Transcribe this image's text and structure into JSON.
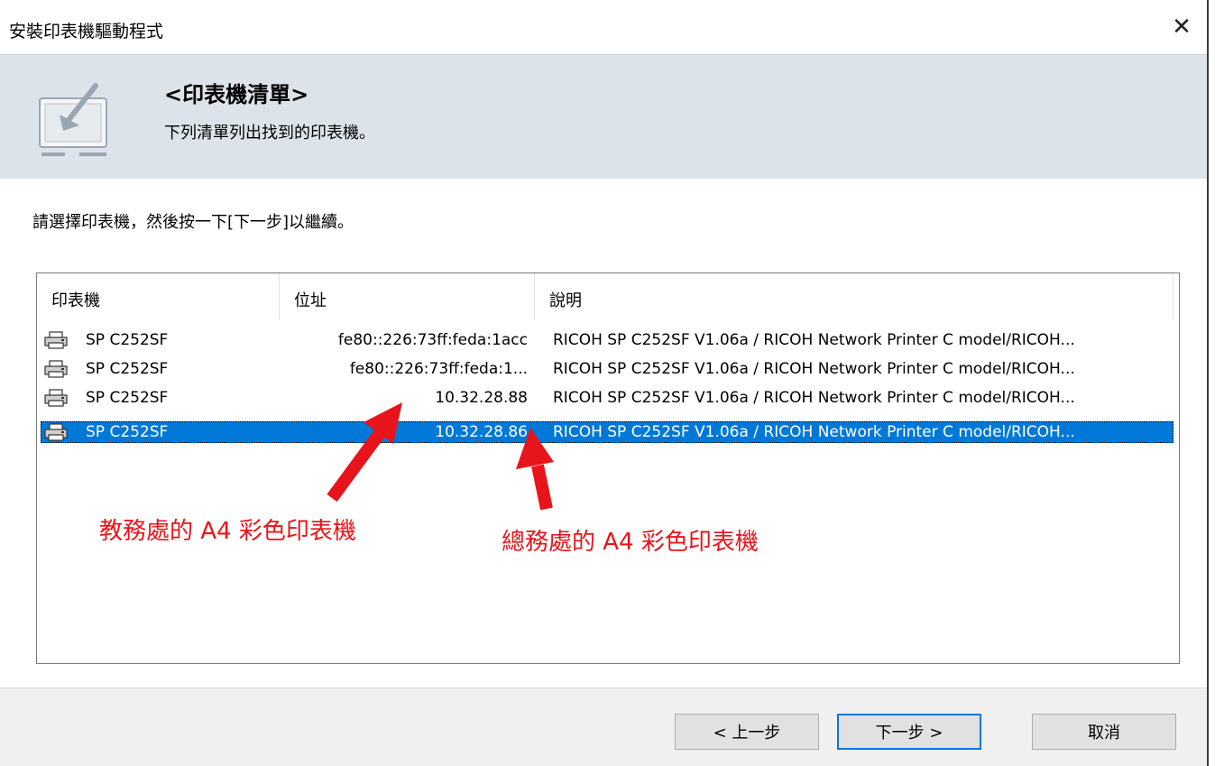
{
  "window": {
    "title": "安裝印表機驅動程式",
    "close_glyph": "✕"
  },
  "banner": {
    "heading": "<印表機清單>",
    "subheading": "下列清單列出找到的印表機。",
    "icon": "install-wizard-icon"
  },
  "instruction": "請選擇印表機，然後按一下[下一步]以繼續。",
  "list": {
    "columns": [
      "印表機",
      "位址",
      "說明"
    ],
    "rows": [
      {
        "name": "SP C252SF",
        "address": "fe80::226:73ff:feda:1acc",
        "description": "RICOH SP C252SF V1.06a / RICOH Network Printer C model/RICOH...",
        "selected": false
      },
      {
        "name": "SP C252SF",
        "address": "fe80::226:73ff:feda:1...",
        "description": "RICOH SP C252SF V1.06a / RICOH Network Printer C model/RICOH...",
        "selected": false
      },
      {
        "name": "SP C252SF",
        "address": "10.32.28.88",
        "description": "RICOH SP C252SF V1.06a / RICOH Network Printer C model/RICOH...",
        "selected": false
      },
      {
        "name": "SP C252SF",
        "address": "10.32.28.86",
        "description": "RICOH SP C252SF V1.06a / RICOH Network Printer C model/RICOH...",
        "selected": true
      }
    ],
    "row_icon": "printer-icon",
    "selection_color": "#0078d7"
  },
  "annotations": {
    "left": "教務處的 A4 彩色印表機",
    "right": "總務處的 A4 彩色印表機",
    "color": "#e8141b"
  },
  "buttons": {
    "back": "< 上一步",
    "next": "下一步 >",
    "cancel": "取消"
  }
}
